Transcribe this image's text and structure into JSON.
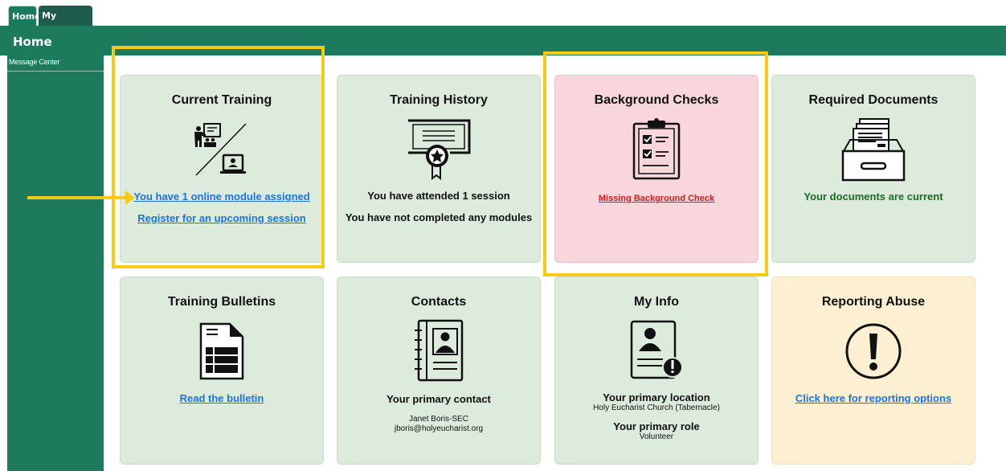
{
  "tabs": [
    {
      "label": "Home"
    },
    {
      "label": "My Diocese"
    }
  ],
  "header": {
    "title": "Home"
  },
  "sidebar": {
    "items": [
      {
        "label": "Message Center"
      }
    ]
  },
  "cards": {
    "current_training": {
      "title": "Current Training",
      "icon": "training-icon",
      "link1": "You have 1 online module assigned",
      "link2": "Register for an upcoming session"
    },
    "training_history": {
      "title": "Training History",
      "icon": "certificate-icon",
      "line1": "You have attended 1 session",
      "line2": "You have not completed any modules"
    },
    "background_checks": {
      "title": "Background Checks",
      "icon": "clipboard-checklist-icon",
      "link": "Missing Background Check"
    },
    "required_documents": {
      "title": "Required Documents",
      "icon": "document-drawer-icon",
      "status": "Your documents are current"
    },
    "training_bulletins": {
      "title": "Training Bulletins",
      "icon": "bulletin-icon",
      "link": "Read the bulletin"
    },
    "contacts": {
      "title": "Contacts",
      "icon": "address-book-icon",
      "label": "Your primary contact",
      "name": "Janet Boris-SEC",
      "email": "jboris@holyeucharist.org"
    },
    "my_info": {
      "title": "My Info",
      "icon": "profile-alert-icon",
      "location_label": "Your primary location",
      "location": "Holy Eucharist Church (Tabernacle)",
      "role_label": "Your primary role",
      "role": "Volunteer"
    },
    "reporting_abuse": {
      "title": "Reporting Abuse",
      "icon": "exclamation-circle-icon",
      "link": "Click here for reporting options"
    }
  },
  "colors": {
    "brand_green": "#1e7a5c",
    "card_green": "#dcebdc",
    "card_red": "#f8d6dc",
    "card_yellow": "#fdf0d2",
    "highlight": "#f7cb15",
    "link_blue": "#1a73e8",
    "alert_red": "#d11c1c",
    "ok_green": "#1b6b23"
  }
}
